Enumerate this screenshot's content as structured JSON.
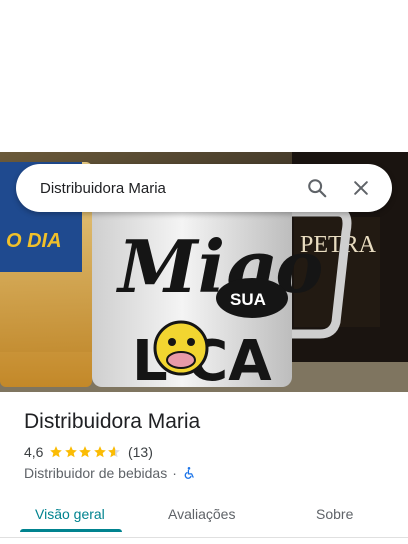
{
  "search": {
    "query": "Distribuidora Maria"
  },
  "hero": {
    "mug_text_line1": "Migo",
    "mug_text_sua": "SUA",
    "mug_text_line2": "L CA",
    "bottle_label": "PETRA",
    "can_label": "O DIA"
  },
  "place": {
    "name": "Distribuidora Maria",
    "rating": "4,6",
    "rating_value": 4.6,
    "review_count": "(13)",
    "category": "Distribuidor de bebidas",
    "separator": "·"
  },
  "tabs": [
    {
      "label": "Visão geral",
      "active": true
    },
    {
      "label": "Avaliações",
      "active": false
    },
    {
      "label": "Sobre",
      "active": false
    }
  ],
  "colors": {
    "accent": "#00838f",
    "star": "#fbbc04",
    "accessibility_icon": "#1a73e8"
  },
  "icons": [
    "search-icon",
    "close-icon",
    "star-icon",
    "wheelchair-icon"
  ]
}
